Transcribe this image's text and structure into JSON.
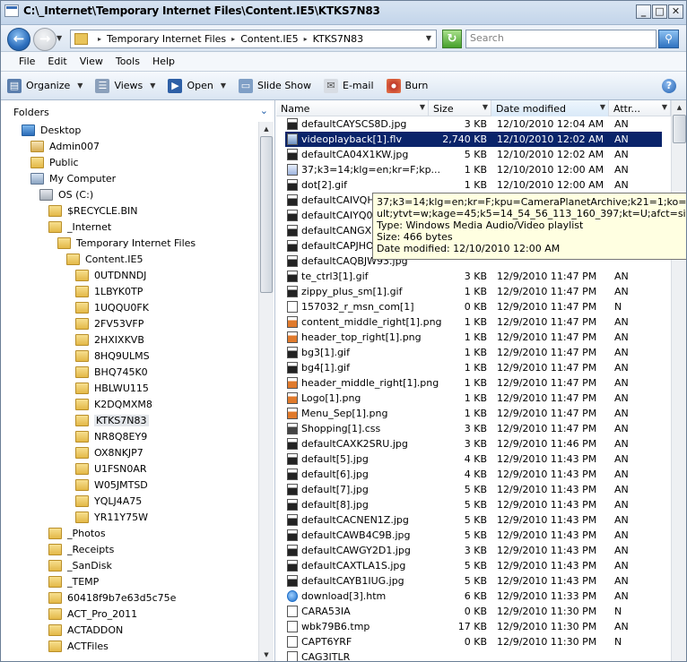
{
  "window": {
    "title": "C:\\_Internet\\Temporary Internet Files\\Content.IE5\\KTKS7N83",
    "controls": {
      "minimize": "_",
      "maximize": "□",
      "close": "✕"
    }
  },
  "address": {
    "crumbs": [
      "Temporary Internet Files",
      "Content.IE5",
      "KTKS7N83"
    ],
    "search_placeholder": "Search"
  },
  "menu": [
    "File",
    "Edit",
    "View",
    "Tools",
    "Help"
  ],
  "toolbar": {
    "organize": "Organize",
    "views": "Views",
    "open": "Open",
    "slideshow": "Slide Show",
    "email": "E-mail",
    "burn": "Burn",
    "help": "?"
  },
  "nav": {
    "header": "Folders",
    "tree": [
      {
        "label": "Desktop",
        "level": 0,
        "type": "desk"
      },
      {
        "label": "Admin007",
        "level": 1,
        "type": "user"
      },
      {
        "label": "Public",
        "level": 1,
        "type": "folder"
      },
      {
        "label": "My Computer",
        "level": 1,
        "type": "comp"
      },
      {
        "label": "OS (C:)",
        "level": 2,
        "type": "drive"
      },
      {
        "label": "$RECYCLE.BIN",
        "level": 3,
        "type": "folder"
      },
      {
        "label": "_Internet",
        "level": 3,
        "type": "folder"
      },
      {
        "label": "Temporary Internet Files",
        "level": 4,
        "type": "folder"
      },
      {
        "label": "Content.IE5",
        "level": 5,
        "type": "folder"
      },
      {
        "label": "0UTDNNDJ",
        "level": 6,
        "type": "folder"
      },
      {
        "label": "1LBYK0TP",
        "level": 6,
        "type": "folder"
      },
      {
        "label": "1UQQU0FK",
        "level": 6,
        "type": "folder"
      },
      {
        "label": "2FV53VFP",
        "level": 6,
        "type": "folder"
      },
      {
        "label": "2HXIXKVB",
        "level": 6,
        "type": "folder"
      },
      {
        "label": "8HQ9ULMS",
        "level": 6,
        "type": "folder"
      },
      {
        "label": "BHQ745K0",
        "level": 6,
        "type": "folder"
      },
      {
        "label": "HBLWU115",
        "level": 6,
        "type": "folder"
      },
      {
        "label": "K2DQMXM8",
        "level": 6,
        "type": "folder"
      },
      {
        "label": "KTKS7N83",
        "level": 6,
        "type": "folder",
        "selected": true
      },
      {
        "label": "NR8Q8EY9",
        "level": 6,
        "type": "folder"
      },
      {
        "label": "OX8NKJP7",
        "level": 6,
        "type": "folder"
      },
      {
        "label": "U1FSN0AR",
        "level": 6,
        "type": "folder"
      },
      {
        "label": "W05JMTSD",
        "level": 6,
        "type": "folder"
      },
      {
        "label": "YQLJ4A75",
        "level": 6,
        "type": "folder"
      },
      {
        "label": "YR11Y75W",
        "level": 6,
        "type": "folder"
      },
      {
        "label": "_Photos",
        "level": 3,
        "type": "folder"
      },
      {
        "label": "_Receipts",
        "level": 3,
        "type": "folder"
      },
      {
        "label": "_SanDisk",
        "level": 3,
        "type": "folder"
      },
      {
        "label": "_TEMP",
        "level": 3,
        "type": "folder"
      },
      {
        "label": "60418f9b7e63d5c75e",
        "level": 3,
        "type": "folder"
      },
      {
        "label": "ACT_Pro_2011",
        "level": 3,
        "type": "folder"
      },
      {
        "label": "ACTADDON",
        "level": 3,
        "type": "folder"
      },
      {
        "label": "ACTFiles",
        "level": 3,
        "type": "folder"
      }
    ]
  },
  "list": {
    "columns": [
      "Name",
      "Size",
      "Date modified",
      "Attr..."
    ],
    "rows": [
      {
        "name": "defaultCAYSCS8D.jpg",
        "size": "3 KB",
        "date": "12/10/2010 12:04 AM",
        "attr": "AN",
        "type": "jpg"
      },
      {
        "name": "videoplayback[1].flv",
        "size": "2,740 KB",
        "date": "12/10/2010 12:02 AM",
        "attr": "AN",
        "type": "flv",
        "selected": true
      },
      {
        "name": "defaultCA04X1KW.jpg",
        "size": "5 KB",
        "date": "12/10/2010 12:02 AM",
        "attr": "AN",
        "type": "jpg"
      },
      {
        "name": "37;k3=14;klg=en;kr=F;kp...",
        "size": "1 KB",
        "date": "12/10/2010 12:00 AM",
        "attr": "AN",
        "type": "pls"
      },
      {
        "name": "dot[2].gif",
        "size": "1 KB",
        "date": "12/10/2010 12:00 AM",
        "attr": "AN",
        "type": "gif"
      },
      {
        "name": "defaultCAIVQHE",
        "size": "",
        "date": "",
        "attr": "",
        "type": "jpg"
      },
      {
        "name": "defaultCAIYQ0I",
        "size": "",
        "date": "",
        "attr": "",
        "type": "jpg"
      },
      {
        "name": "defaultCANGXP8",
        "size": "",
        "date": "",
        "attr": "",
        "type": "jpg"
      },
      {
        "name": "defaultCAPJHOY",
        "size": "",
        "date": "",
        "attr": "",
        "type": "jpg"
      },
      {
        "name": "defaultCAQBJW93.jpg",
        "size": "",
        "date": "",
        "attr": "",
        "type": "jpg"
      },
      {
        "name": "te_ctrl3[1].gif",
        "size": "3 KB",
        "date": "12/9/2010 11:47 PM",
        "attr": "AN",
        "type": "gif"
      },
      {
        "name": "zippy_plus_sm[1].gif",
        "size": "1 KB",
        "date": "12/9/2010 11:47 PM",
        "attr": "AN",
        "type": "gif"
      },
      {
        "name": "157032_r_msn_com[1]",
        "size": "0 KB",
        "date": "12/9/2010 11:47 PM",
        "attr": "N",
        "type": "blank"
      },
      {
        "name": "content_middle_right[1].png",
        "size": "1 KB",
        "date": "12/9/2010 11:47 PM",
        "attr": "AN",
        "type": "png"
      },
      {
        "name": "header_top_right[1].png",
        "size": "1 KB",
        "date": "12/9/2010 11:47 PM",
        "attr": "AN",
        "type": "png"
      },
      {
        "name": "bg3[1].gif",
        "size": "1 KB",
        "date": "12/9/2010 11:47 PM",
        "attr": "AN",
        "type": "gif"
      },
      {
        "name": "bg4[1].gif",
        "size": "1 KB",
        "date": "12/9/2010 11:47 PM",
        "attr": "AN",
        "type": "gif"
      },
      {
        "name": "header_middle_right[1].png",
        "size": "1 KB",
        "date": "12/9/2010 11:47 PM",
        "attr": "AN",
        "type": "png"
      },
      {
        "name": "Logo[1].png",
        "size": "1 KB",
        "date": "12/9/2010 11:47 PM",
        "attr": "AN",
        "type": "png"
      },
      {
        "name": "Menu_Sep[1].png",
        "size": "1 KB",
        "date": "12/9/2010 11:47 PM",
        "attr": "AN",
        "type": "png"
      },
      {
        "name": "Shopping[1].css",
        "size": "3 KB",
        "date": "12/9/2010 11:47 PM",
        "attr": "AN",
        "type": "css"
      },
      {
        "name": "defaultCAXK2SRU.jpg",
        "size": "3 KB",
        "date": "12/9/2010 11:46 PM",
        "attr": "AN",
        "type": "jpg"
      },
      {
        "name": "default[5].jpg",
        "size": "4 KB",
        "date": "12/9/2010 11:43 PM",
        "attr": "AN",
        "type": "jpg"
      },
      {
        "name": "default[6].jpg",
        "size": "4 KB",
        "date": "12/9/2010 11:43 PM",
        "attr": "AN",
        "type": "jpg"
      },
      {
        "name": "default[7].jpg",
        "size": "5 KB",
        "date": "12/9/2010 11:43 PM",
        "attr": "AN",
        "type": "jpg"
      },
      {
        "name": "default[8].jpg",
        "size": "5 KB",
        "date": "12/9/2010 11:43 PM",
        "attr": "AN",
        "type": "jpg"
      },
      {
        "name": "defaultCACNEN1Z.jpg",
        "size": "5 KB",
        "date": "12/9/2010 11:43 PM",
        "attr": "AN",
        "type": "jpg"
      },
      {
        "name": "defaultCAWB4C9B.jpg",
        "size": "5 KB",
        "date": "12/9/2010 11:43 PM",
        "attr": "AN",
        "type": "jpg"
      },
      {
        "name": "defaultCAWGY2D1.jpg",
        "size": "3 KB",
        "date": "12/9/2010 11:43 PM",
        "attr": "AN",
        "type": "jpg"
      },
      {
        "name": "defaultCAXTLA1S.jpg",
        "size": "5 KB",
        "date": "12/9/2010 11:43 PM",
        "attr": "AN",
        "type": "jpg"
      },
      {
        "name": "defaultCAYB1IUG.jpg",
        "size": "5 KB",
        "date": "12/9/2010 11:43 PM",
        "attr": "AN",
        "type": "jpg"
      },
      {
        "name": "download[3].htm",
        "size": "6 KB",
        "date": "12/9/2010 11:33 PM",
        "attr": "AN",
        "type": "htm"
      },
      {
        "name": "CARA53IA",
        "size": "0 KB",
        "date": "12/9/2010 11:30 PM",
        "attr": "N",
        "type": "blank"
      },
      {
        "name": "wbk79B6.tmp",
        "size": "17 KB",
        "date": "12/9/2010 11:30 PM",
        "attr": "AN",
        "type": "blank"
      },
      {
        "name": "CAPT6YRF",
        "size": "0 KB",
        "date": "12/9/2010 11:30 PM",
        "attr": "N",
        "type": "blank"
      },
      {
        "name": "CAG3ITLR",
        "size": "",
        "date": "",
        "attr": "",
        "type": "blank"
      }
    ]
  },
  "tooltip": {
    "line1": "37;k3=14;klg=en;kr=F;kpu=CameraPlanetArchive;k21=1;ko=p;afc=1;",
    "line2": "ult;ytvt=w;kage=45;k5=14_54_56_113_160_397;kt=U;afct=sit",
    "type": "Type: Windows Media Audio/Video playlist",
    "size": "Size: 466 bytes",
    "date": "Date modified: 12/10/2010 12:00 AM"
  }
}
